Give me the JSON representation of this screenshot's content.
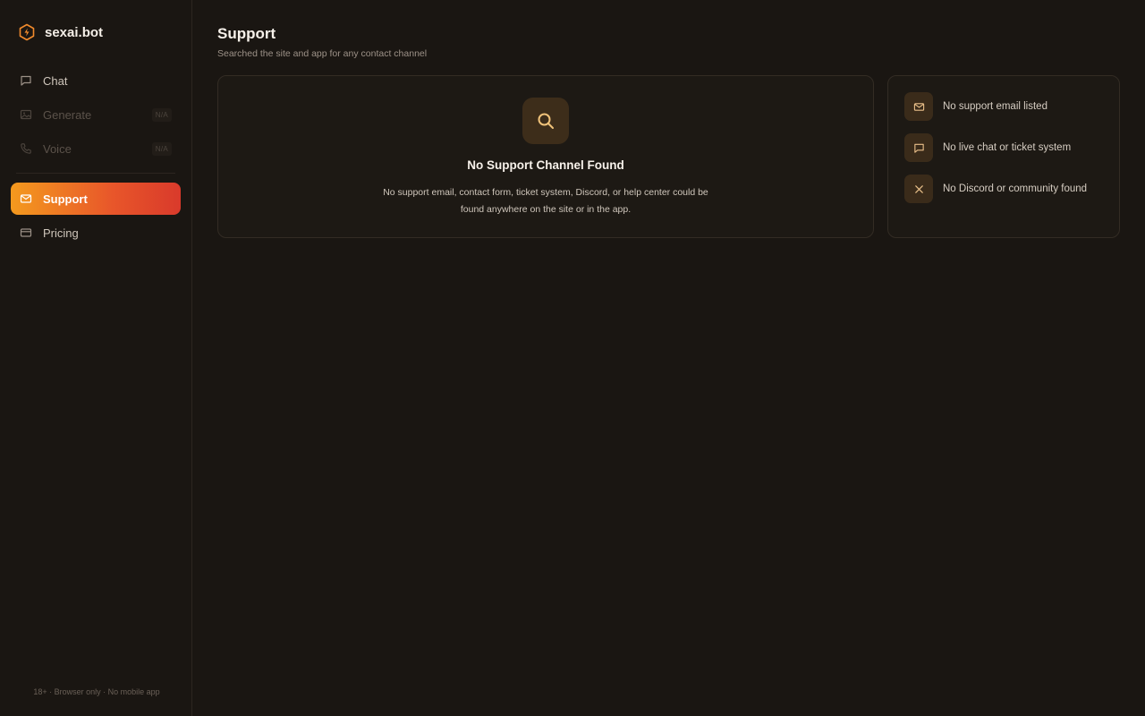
{
  "brand": {
    "name": "sexai.bot",
    "logo_icon": "hexagon-bolt-icon",
    "accent": "#f08a2c"
  },
  "sidebar": {
    "items": [
      {
        "label": "Chat",
        "icon": "chat-bubble-icon",
        "state": "default",
        "badge": ""
      },
      {
        "label": "Generate",
        "icon": "image-icon",
        "state": "disabled",
        "badge": "N/A"
      },
      {
        "label": "Voice",
        "icon": "phone-icon",
        "state": "disabled",
        "badge": "N/A"
      },
      {
        "label": "Support",
        "icon": "mail-icon",
        "state": "active",
        "badge": ""
      },
      {
        "label": "Pricing",
        "icon": "credit-card-icon",
        "state": "default",
        "badge": ""
      }
    ],
    "footer": "18+ · Browser only · No mobile app"
  },
  "main": {
    "title": "Support",
    "subtitle": "Searched the site and app for any contact channel",
    "result_card": {
      "icon": "search-icon",
      "title": "No Support Channel Found",
      "description": "No support email, contact form, ticket system, Discord, or help center could be found anywhere on the site or in the app."
    },
    "checklist": [
      {
        "icon": "mail-icon",
        "text": "No support email listed"
      },
      {
        "icon": "chat-bubble-icon",
        "text": "No live chat or ticket system"
      },
      {
        "icon": "close-icon",
        "text": "No Discord or community found"
      }
    ]
  },
  "colors": {
    "background": "#1a1612",
    "card_border": "#332c24",
    "active_gradient_start": "#f49a1e",
    "active_gradient_end": "#d93a2b"
  }
}
